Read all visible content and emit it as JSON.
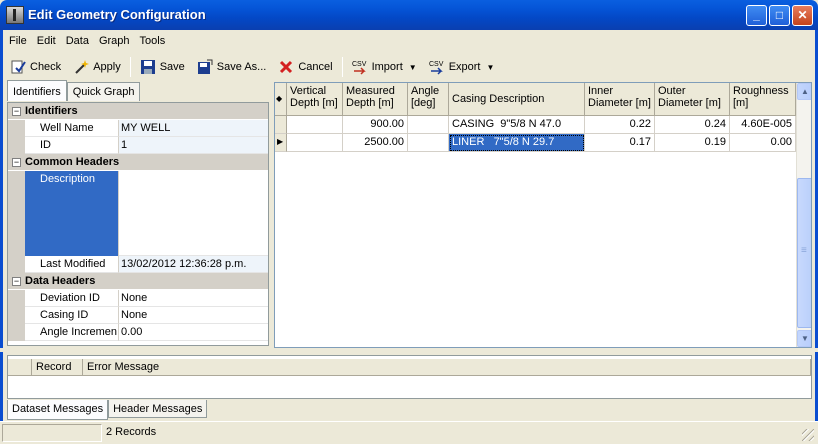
{
  "window": {
    "title": "Edit Geometry Configuration"
  },
  "menu": [
    "File",
    "Edit",
    "Data",
    "Graph",
    "Tools"
  ],
  "toolbar": {
    "check": "Check",
    "apply": "Apply",
    "save": "Save",
    "save_as": "Save As...",
    "cancel": "Cancel",
    "import": "Import",
    "export": "Export",
    "csv": "CSV"
  },
  "left_tabs": [
    "Identifiers",
    "Quick Graph"
  ],
  "props": {
    "cat_identifiers": "Identifiers",
    "well_name_key": "Well Name",
    "well_name_val": "MY WELL",
    "id_key": "ID",
    "id_val": "1",
    "cat_common": "Common Headers",
    "description_key": "Description",
    "description_val": "",
    "last_modified_key": "Last Modified",
    "last_modified_val": "13/02/2012 12:36:28 p.m.",
    "cat_data": "Data Headers",
    "deviation_key": "Deviation ID",
    "deviation_val": "None",
    "casing_key": "Casing ID",
    "casing_val": "None",
    "angle_key": "Angle Incremen",
    "angle_val": "0.00"
  },
  "grid": {
    "headers": [
      "Vertical\nDepth [m]",
      "Measured\nDepth [m]",
      "Angle\n[deg]",
      "Casing Description",
      "Inner\nDiameter [m]",
      "Outer\nDiameter [m]",
      "Roughness\n[m]"
    ],
    "rows": [
      [
        "",
        "900.00",
        "",
        "CASING  9\"5/8 N 47.0",
        "0.22",
        "0.24",
        "4.60E-005"
      ],
      [
        "",
        "2500.00",
        "",
        "LINER   7\"5/8 N 29.7",
        "0.17",
        "0.19",
        "0.00"
      ]
    ]
  },
  "messages": {
    "col_record": "Record",
    "col_error": "Error Message"
  },
  "bottom_tabs": [
    "Dataset Messages",
    "Header Messages"
  ],
  "status": {
    "records": "2 Records"
  }
}
